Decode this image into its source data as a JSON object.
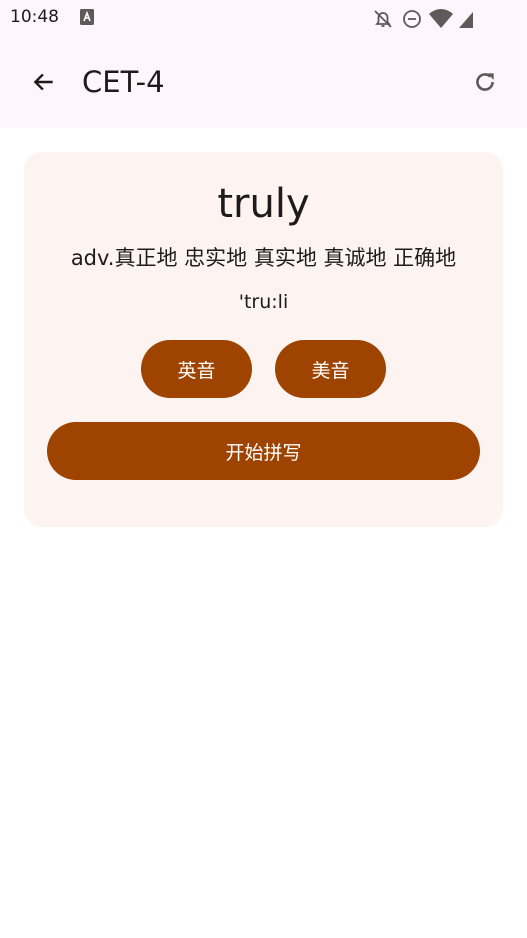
{
  "status_bar": {
    "time": "10:48",
    "icons": [
      "a-badge-icon",
      "notifications-off-icon",
      "do-not-disturb-icon",
      "wifi-icon",
      "signal-icon"
    ]
  },
  "app_bar": {
    "title": "CET-4",
    "back_icon": "arrow-back-icon",
    "refresh_icon": "refresh-icon"
  },
  "card": {
    "word": "truly",
    "meaning": "adv.真正地 忠实地 真实地 真诚地 正确地",
    "phonetic": "'tru:li",
    "uk_label": "英音",
    "us_label": "美音",
    "spell_label": "开始拼写"
  },
  "colors": {
    "accent": "#9e4300",
    "card_background": "#fdf4f1",
    "bar_background": "#fdf6fc"
  }
}
